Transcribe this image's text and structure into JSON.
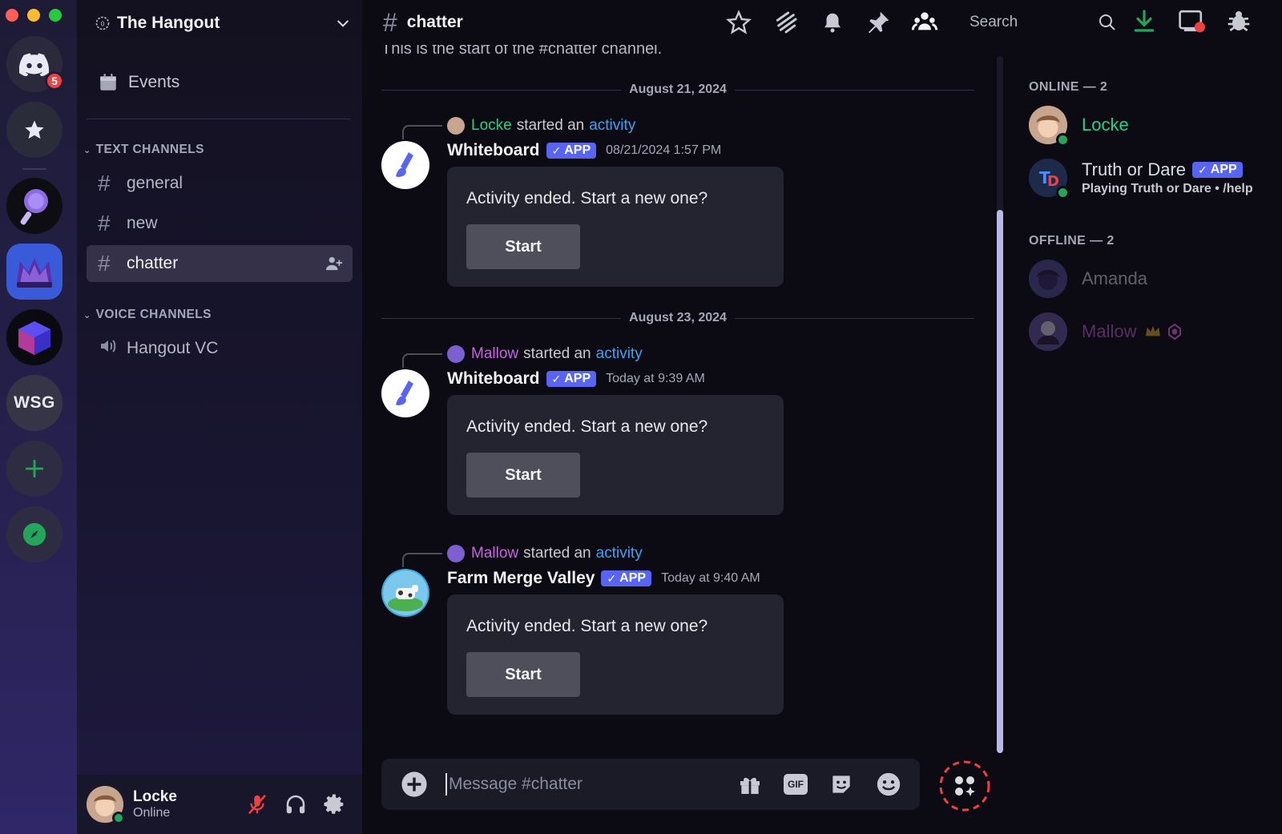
{
  "window": {
    "traffic_lights": [
      "close",
      "minimize",
      "zoom"
    ]
  },
  "rail": {
    "home_badge": "5",
    "servers": [
      {
        "name": "direct-messages"
      },
      {
        "name": "nitro-favorites"
      },
      {
        "name": "server-magnifier"
      },
      {
        "name": "server-crown"
      },
      {
        "name": "server-cube"
      },
      {
        "name": "WSG",
        "label": "WSG"
      },
      {
        "name": "add-server"
      },
      {
        "name": "discover"
      }
    ]
  },
  "server": {
    "title": "The Hangout"
  },
  "sidebar": {
    "events_label": "Events",
    "text_category": "TEXT CHANNELS",
    "text_channels": [
      {
        "label": "general"
      },
      {
        "label": "new"
      },
      {
        "label": "chatter"
      }
    ],
    "voice_category": "VOICE CHANNELS",
    "voice_channels": [
      {
        "label": "Hangout VC"
      }
    ]
  },
  "user_panel": {
    "name": "Locke",
    "status": "Online"
  },
  "topbar": {
    "channel": "chatter",
    "search_placeholder": "Search"
  },
  "chat": {
    "start_note": "This is the start of the #chatter channel.",
    "groups": [
      {
        "date": "August 21, 2024",
        "starter": "Locke",
        "started_text": "started an",
        "activity_word": "activity",
        "author": "Whiteboard",
        "app_tag": "APP",
        "time": "08/21/2024 1:57 PM",
        "card_text": "Activity ended. Start a new one?",
        "button": "Start"
      },
      {
        "date": "August 23, 2024",
        "starter": "Mallow",
        "started_text": "started an",
        "activity_word": "activity",
        "author": "Whiteboard",
        "app_tag": "APP",
        "time": "Today at 9:39 AM",
        "card_text": "Activity ended. Start a new one?",
        "button": "Start"
      },
      {
        "starter": "Mallow",
        "started_text": "started an",
        "activity_word": "activity",
        "author": "Farm Merge Valley",
        "app_tag": "APP",
        "time": "Today at 9:40 AM",
        "card_text": "Activity ended. Start a new one?",
        "button": "Start"
      }
    ]
  },
  "composer": {
    "placeholder": "Message #chatter",
    "gif_label": "GIF"
  },
  "members": {
    "online_header": "ONLINE — 2",
    "offline_header": "OFFLINE — 2",
    "online": [
      {
        "name": "Locke",
        "color": "#23d18b"
      },
      {
        "name": "Truth or Dare",
        "app_tag": "APP",
        "activity": "Playing Truth or Dare • /help",
        "color": "#dbdee1"
      }
    ],
    "offline": [
      {
        "name": "Amanda",
        "color": "#dbdee1"
      },
      {
        "name": "Mallow",
        "color": "#c864e0"
      }
    ]
  },
  "colors": {
    "accent": "#5865f2",
    "online": "#23a55a",
    "danger": "#f23f43"
  }
}
